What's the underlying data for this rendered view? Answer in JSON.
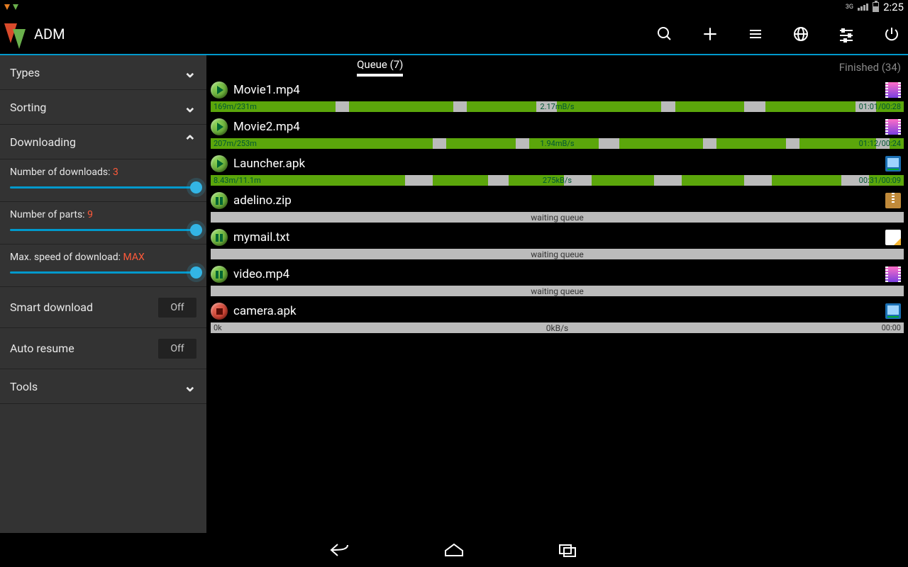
{
  "status": {
    "net": "3G",
    "time": "2:25"
  },
  "app": {
    "title": "ADM"
  },
  "actions": [
    "search",
    "add",
    "list",
    "globe",
    "settings",
    "power"
  ],
  "sidebar": {
    "types_label": "Types",
    "sorting_label": "Sorting",
    "downloading_label": "Downloading",
    "sliders": [
      {
        "label": "Number of downloads:",
        "value": "3"
      },
      {
        "label": "Number of parts:",
        "value": "9"
      },
      {
        "label": "Max. speed of download:",
        "value": "MAX"
      }
    ],
    "toggles": [
      {
        "label": "Smart download",
        "state": "Off"
      },
      {
        "label": "Auto resume",
        "state": "Off"
      }
    ],
    "tools_label": "Tools"
  },
  "tabs": {
    "queue": "Queue (7)",
    "finished": "Finished (34)"
  },
  "items": [
    {
      "state": "play",
      "name": "Movie1.mp4",
      "type": "video",
      "left": "169m/231m",
      "mid": "2.17mB/s",
      "right": "01:01/00:28",
      "segments": [
        18,
        2,
        15,
        2,
        10,
        3,
        15,
        2,
        10,
        3,
        13,
        3,
        4
      ],
      "bar": "green"
    },
    {
      "state": "play",
      "name": "Movie2.mp4",
      "type": "video",
      "left": "207m/253m",
      "mid": "1.94mB/s",
      "right": "01:12/00:24",
      "segments": [
        32,
        2,
        10,
        2,
        10,
        3,
        12,
        2,
        10,
        2,
        11,
        2,
        2
      ],
      "bar": "green"
    },
    {
      "state": "play",
      "name": "Launcher.apk",
      "type": "app",
      "left": "8.43m/11.1m",
      "mid": "275kB/s",
      "right": "00:31/00:09",
      "segments": [
        28,
        4,
        8,
        3,
        8,
        4,
        9,
        4,
        9,
        4,
        10,
        4,
        5
      ],
      "bar": "green"
    },
    {
      "state": "pause",
      "name": "adelino.zip",
      "type": "zip",
      "mid": "waiting queue",
      "bar": "waiting"
    },
    {
      "state": "pause",
      "name": "mymail.txt",
      "type": "txt",
      "mid": "waiting queue",
      "bar": "waiting"
    },
    {
      "state": "pause",
      "name": "video.mp4",
      "type": "video",
      "mid": "waiting queue",
      "bar": "waiting"
    },
    {
      "state": "stop",
      "name": "camera.apk",
      "type": "app",
      "left": "0k",
      "mid": "0kB/s",
      "right": "00:00",
      "bar": "gray"
    }
  ]
}
